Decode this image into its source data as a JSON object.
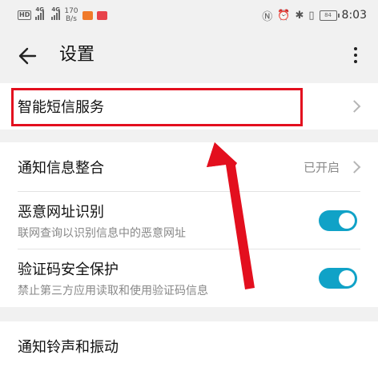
{
  "status_bar": {
    "network_1": "4G",
    "network_2": "4G",
    "speed_value": "170",
    "speed_unit": "B/s",
    "hd_badge": "HD",
    "battery": "84",
    "time": "8:03"
  },
  "app_bar": {
    "title": "设置"
  },
  "items": {
    "smart_sms": {
      "label": "智能短信服务"
    },
    "notification_merge": {
      "label": "通知信息整合",
      "status": "已开启"
    },
    "malicious_url": {
      "label": "恶意网址识别",
      "sub": "联网查询以识别信息中的恶意网址",
      "enabled": true
    },
    "verification_code": {
      "label": "验证码安全保护",
      "sub": "禁止第三方应用读取和使用验证码信息",
      "enabled": true
    },
    "ringtone_vibration": {
      "label": "通知铃声和振动"
    }
  },
  "colors": {
    "accent": "#10a2c7",
    "highlight": "#e30f1e",
    "background": "#f1f1f1"
  },
  "icons": [
    "back-arrow-icon",
    "more-vert-icon",
    "chevron-right-icon",
    "nfc-icon",
    "alarm-icon",
    "bluetooth-icon",
    "vibrate-icon",
    "battery-icon"
  ]
}
